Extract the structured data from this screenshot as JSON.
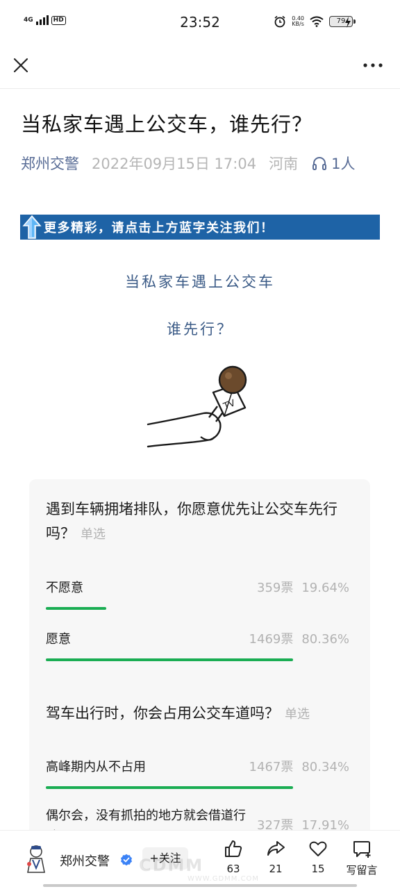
{
  "status_bar": {
    "network": "4G",
    "hd_label": "HD",
    "time": "23:52",
    "speed_value": "0.40",
    "speed_unit": "KB/s",
    "battery": "79"
  },
  "nav": {
    "close_icon": "close-icon",
    "more_icon": "more-icon"
  },
  "article": {
    "title": "当私家车遇上公交车，谁先行？",
    "author": "郑州交警",
    "date": "2022年09月15日 17:04",
    "region": "河南",
    "listeners": "1人",
    "banner_text": "更多精彩，请点击上方蓝字关注我们！",
    "subheading_1": "当私家车遇上公交车",
    "subheading_2": "谁先行？"
  },
  "votes": [
    {
      "question": "遇到车辆拥堵排队，你愿意优先让公交车先行吗？",
      "type": "单选",
      "options": [
        {
          "label": "不愿意",
          "votes": "359票",
          "percent": "19.64%",
          "fraction": 0.1964
        },
        {
          "label": "愿意",
          "votes": "1469票",
          "percent": "80.36%",
          "fraction": 0.8036
        }
      ]
    },
    {
      "question": "驾车出行时，你会占用公交车道吗？",
      "type": "单选",
      "options": [
        {
          "label": "高峰期内从不占用",
          "votes": "1467票",
          "percent": "80.34%",
          "fraction": 0.8034
        },
        {
          "label": "偶尔会，没有抓拍的地方就会借道行驶",
          "votes": "327票",
          "percent": "17.91%",
          "fraction": 0.1791
        }
      ]
    }
  ],
  "bottom_bar": {
    "account_name": "郑州交警",
    "follow_label": "+关注",
    "like_count": "63",
    "share_count": "21",
    "favorite_count": "15",
    "comment_label": "写留言"
  },
  "watermark": {
    "text": "CDMM",
    "url": "WWW.GDMM.COM"
  },
  "colors": {
    "link_blue": "#576b95",
    "banner_blue": "#1e63a6",
    "progress_green": "#1aad53",
    "subheading_blue": "#3a5a86"
  }
}
